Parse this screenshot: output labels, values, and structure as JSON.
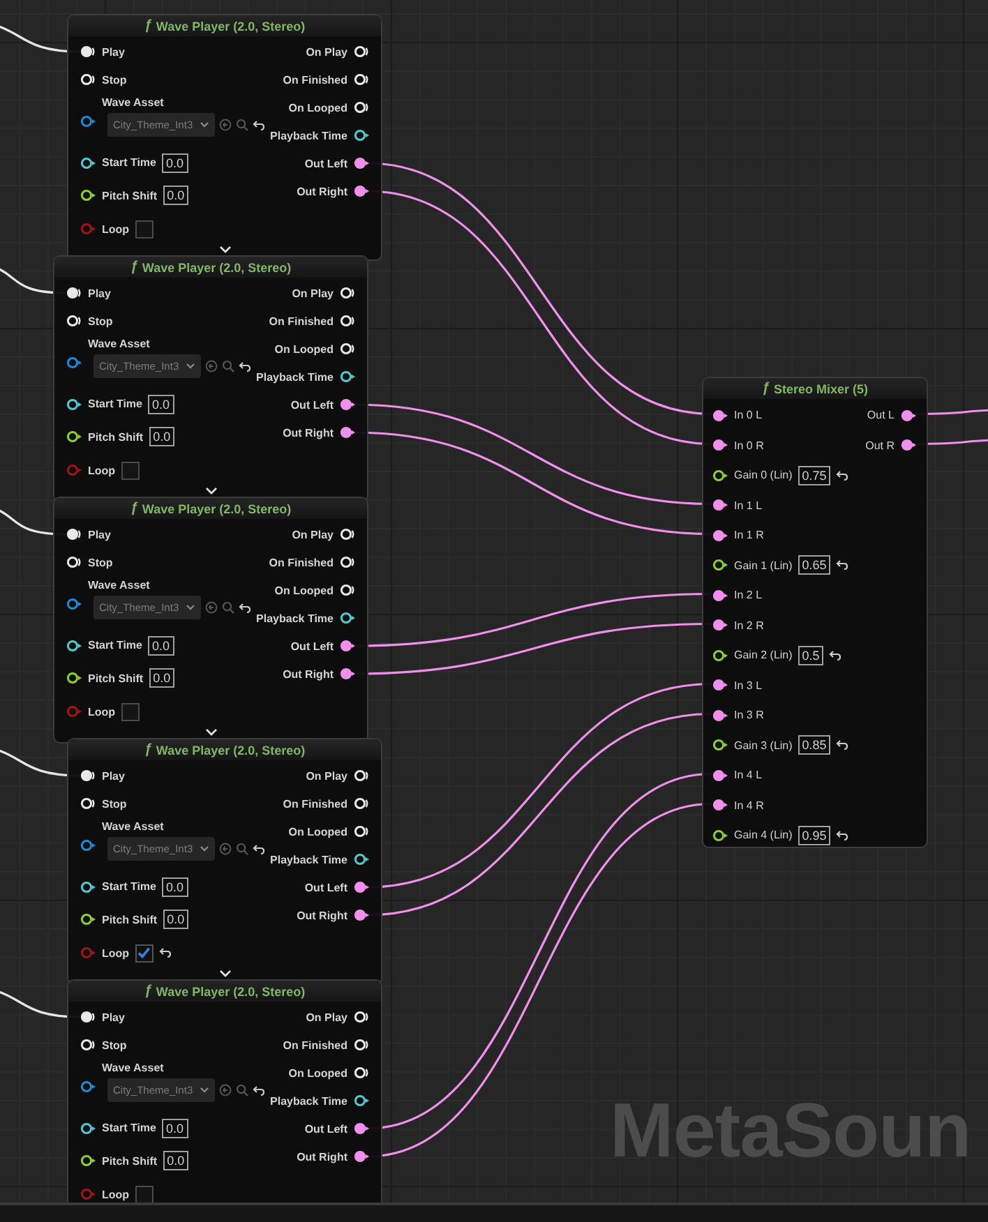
{
  "wave_players": [
    {
      "function_symbol": "ƒ",
      "title": "Wave Player (2.0, Stereo)",
      "inputs": [
        {
          "kind": "trigger",
          "label": "Play",
          "connected": true
        },
        {
          "kind": "trigger",
          "label": "Stop",
          "connected": false
        },
        {
          "kind": "asset",
          "label": "Wave Asset",
          "connected": false,
          "value": "City_Theme_Int3"
        },
        {
          "kind": "time",
          "label": "Start Time",
          "connected": false,
          "value": "0.0"
        },
        {
          "kind": "float",
          "label": "Pitch Shift",
          "connected": false,
          "value": "0.0"
        },
        {
          "kind": "bool",
          "label": "Loop",
          "connected": false,
          "checked": false
        }
      ],
      "outputs": [
        {
          "kind": "trigger",
          "label": "On Play",
          "connected": false
        },
        {
          "kind": "trigger",
          "label": "On Finished",
          "connected": false
        },
        {
          "kind": "trigger",
          "label": "On Looped",
          "connected": false
        },
        {
          "kind": "time",
          "label": "Playback Time",
          "connected": false
        },
        {
          "kind": "audio",
          "label": "Out Left",
          "connected": true
        },
        {
          "kind": "audio",
          "label": "Out Right",
          "connected": true
        }
      ]
    },
    {
      "function_symbol": "ƒ",
      "title": "Wave Player (2.0, Stereo)",
      "inputs": [
        {
          "kind": "trigger",
          "label": "Play",
          "connected": true
        },
        {
          "kind": "trigger",
          "label": "Stop",
          "connected": false
        },
        {
          "kind": "asset",
          "label": "Wave Asset",
          "connected": false,
          "value": "City_Theme_Int3"
        },
        {
          "kind": "time",
          "label": "Start Time",
          "connected": false,
          "value": "0.0"
        },
        {
          "kind": "float",
          "label": "Pitch Shift",
          "connected": false,
          "value": "0.0"
        },
        {
          "kind": "bool",
          "label": "Loop",
          "connected": false,
          "checked": false
        }
      ],
      "outputs": [
        {
          "kind": "trigger",
          "label": "On Play",
          "connected": false
        },
        {
          "kind": "trigger",
          "label": "On Finished",
          "connected": false
        },
        {
          "kind": "trigger",
          "label": "On Looped",
          "connected": false
        },
        {
          "kind": "time",
          "label": "Playback Time",
          "connected": false
        },
        {
          "kind": "audio",
          "label": "Out Left",
          "connected": true
        },
        {
          "kind": "audio",
          "label": "Out Right",
          "connected": true
        }
      ]
    },
    {
      "function_symbol": "ƒ",
      "title": "Wave Player (2.0, Stereo)",
      "inputs": [
        {
          "kind": "trigger",
          "label": "Play",
          "connected": true
        },
        {
          "kind": "trigger",
          "label": "Stop",
          "connected": false
        },
        {
          "kind": "asset",
          "label": "Wave Asset",
          "connected": false,
          "value": "City_Theme_Int3"
        },
        {
          "kind": "time",
          "label": "Start Time",
          "connected": false,
          "value": "0.0"
        },
        {
          "kind": "float",
          "label": "Pitch Shift",
          "connected": false,
          "value": "0.0"
        },
        {
          "kind": "bool",
          "label": "Loop",
          "connected": false,
          "checked": false
        }
      ],
      "outputs": [
        {
          "kind": "trigger",
          "label": "On Play",
          "connected": false
        },
        {
          "kind": "trigger",
          "label": "On Finished",
          "connected": false
        },
        {
          "kind": "trigger",
          "label": "On Looped",
          "connected": false
        },
        {
          "kind": "time",
          "label": "Playback Time",
          "connected": false
        },
        {
          "kind": "audio",
          "label": "Out Left",
          "connected": true
        },
        {
          "kind": "audio",
          "label": "Out Right",
          "connected": true
        }
      ]
    },
    {
      "function_symbol": "ƒ",
      "title": "Wave Player (2.0, Stereo)",
      "inputs": [
        {
          "kind": "trigger",
          "label": "Play",
          "connected": true
        },
        {
          "kind": "trigger",
          "label": "Stop",
          "connected": false
        },
        {
          "kind": "asset",
          "label": "Wave Asset",
          "connected": false,
          "value": "City_Theme_Int3"
        },
        {
          "kind": "time",
          "label": "Start Time",
          "connected": false,
          "value": "0.0"
        },
        {
          "kind": "float",
          "label": "Pitch Shift",
          "connected": false,
          "value": "0.0"
        },
        {
          "kind": "bool",
          "label": "Loop",
          "connected": false,
          "checked": true
        }
      ],
      "outputs": [
        {
          "kind": "trigger",
          "label": "On Play",
          "connected": false
        },
        {
          "kind": "trigger",
          "label": "On Finished",
          "connected": false
        },
        {
          "kind": "trigger",
          "label": "On Looped",
          "connected": false
        },
        {
          "kind": "time",
          "label": "Playback Time",
          "connected": false
        },
        {
          "kind": "audio",
          "label": "Out Left",
          "connected": true
        },
        {
          "kind": "audio",
          "label": "Out Right",
          "connected": true
        }
      ]
    },
    {
      "function_symbol": "ƒ",
      "title": "Wave Player (2.0, Stereo)",
      "inputs": [
        {
          "kind": "trigger",
          "label": "Play",
          "connected": true
        },
        {
          "kind": "trigger",
          "label": "Stop",
          "connected": false
        },
        {
          "kind": "asset",
          "label": "Wave Asset",
          "connected": false,
          "value": "City_Theme_Int3"
        },
        {
          "kind": "time",
          "label": "Start Time",
          "connected": false,
          "value": "0.0"
        },
        {
          "kind": "float",
          "label": "Pitch Shift",
          "connected": false,
          "value": "0.0"
        },
        {
          "kind": "bool",
          "label": "Loop",
          "connected": false,
          "checked": false
        }
      ],
      "outputs": [
        {
          "kind": "trigger",
          "label": "On Play",
          "connected": false
        },
        {
          "kind": "trigger",
          "label": "On Finished",
          "connected": false
        },
        {
          "kind": "trigger",
          "label": "On Looped",
          "connected": false
        },
        {
          "kind": "time",
          "label": "Playback Time",
          "connected": false
        },
        {
          "kind": "audio",
          "label": "Out Left",
          "connected": true
        },
        {
          "kind": "audio",
          "label": "Out Right",
          "connected": true
        }
      ]
    }
  ],
  "mixer": {
    "function_symbol": "ƒ",
    "title": "Stereo Mixer (5)",
    "inputs": [
      {
        "kind": "audio",
        "label": "In 0 L",
        "connected": true
      },
      {
        "kind": "audio",
        "label": "In 0 R",
        "connected": true
      },
      {
        "kind": "float",
        "label": "Gain 0 (Lin)",
        "connected": false,
        "value": "0.75"
      },
      {
        "kind": "audio",
        "label": "In 1 L",
        "connected": true
      },
      {
        "kind": "audio",
        "label": "In 1 R",
        "connected": true
      },
      {
        "kind": "float",
        "label": "Gain 1 (Lin)",
        "connected": false,
        "value": "0.65"
      },
      {
        "kind": "audio",
        "label": "In 2 L",
        "connected": true
      },
      {
        "kind": "audio",
        "label": "In 2 R",
        "connected": true
      },
      {
        "kind": "float",
        "label": "Gain 2 (Lin)",
        "connected": false,
        "value": "0.5"
      },
      {
        "kind": "audio",
        "label": "In 3 L",
        "connected": true
      },
      {
        "kind": "audio",
        "label": "In 3 R",
        "connected": true
      },
      {
        "kind": "float",
        "label": "Gain 3 (Lin)",
        "connected": false,
        "value": "0.85"
      },
      {
        "kind": "audio",
        "label": "In 4 L",
        "connected": true
      },
      {
        "kind": "audio",
        "label": "In 4 R",
        "connected": true
      },
      {
        "kind": "float",
        "label": "Gain 4 (Lin)",
        "connected": false,
        "value": "0.95"
      }
    ],
    "outputs": [
      {
        "kind": "audio",
        "label": "Out L",
        "connected": true
      },
      {
        "kind": "audio",
        "label": "Out R",
        "connected": true
      }
    ]
  },
  "graph_label": "MetaSoun"
}
